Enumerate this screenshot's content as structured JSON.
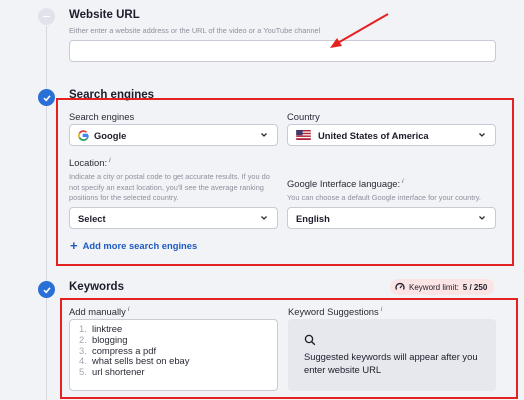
{
  "website_url": {
    "title": "Website URL",
    "hint": "Either enter a website address or the URL of the video or a YouTube channel",
    "value": ""
  },
  "search_engines": {
    "title": "Search engines",
    "engine_label": "Search engines",
    "engine_value": "Google",
    "country_label": "Country",
    "country_value": "United States of America",
    "location_label": "Location:",
    "location_info": "i",
    "location_hint": "Indicate a city or postal code to get accurate results. If you do not specify an exact location, you'll see the average ranking positions for the selected country.",
    "location_value": "Select",
    "language_label": "Google Interface language:",
    "language_info": "i",
    "language_hint": "You can choose a default Google interface for your country.",
    "language_value": "English",
    "add_more_label": "Add more search engines"
  },
  "keywords": {
    "title": "Keywords",
    "limit_label": "Keyword limit:",
    "limit_value": "5 / 250",
    "add_manually_label": "Add manually",
    "add_manually_info": "i",
    "suggestions_label": "Keyword Suggestions",
    "suggestions_info": "i",
    "items": [
      {
        "num": "1.",
        "text": "linktree"
      },
      {
        "num": "2.",
        "text": "blogging"
      },
      {
        "num": "3.",
        "text": "compress a pdf"
      },
      {
        "num": "4.",
        "text": "what sells best on ebay"
      },
      {
        "num": "5.",
        "text": "url shortener"
      }
    ],
    "suggestions_message": "Suggested keywords will appear after you enter website URL"
  },
  "colors": {
    "accent_blue": "#2a6fd6",
    "annotation_red": "#e42222",
    "link_blue": "#1f5bbf"
  }
}
